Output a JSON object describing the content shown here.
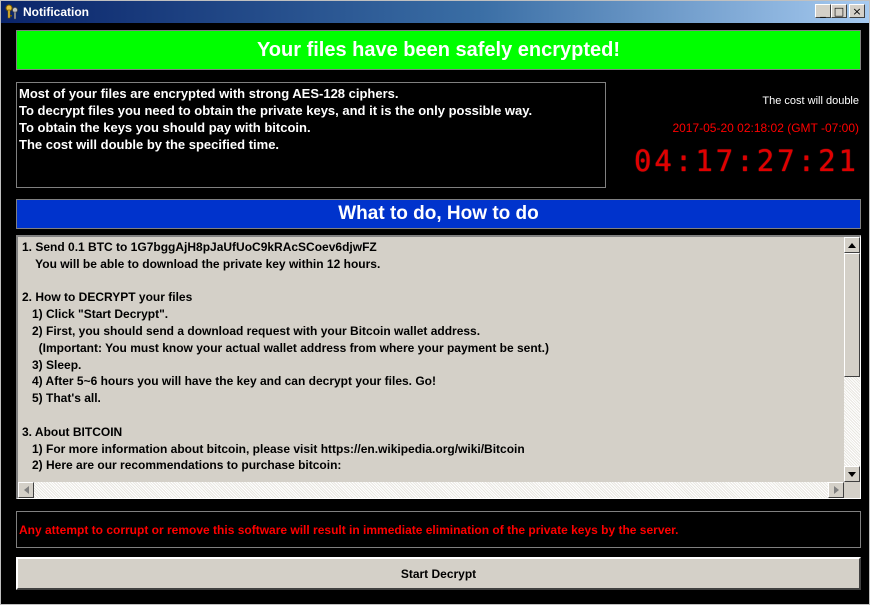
{
  "window": {
    "title": "Notification",
    "minimize_glyph": "_",
    "maximize_glyph": "□",
    "close_glyph": "×"
  },
  "header": {
    "banner": "Your files have been safely encrypted!",
    "banner_color": "#00ff00"
  },
  "info": {
    "lines": [
      "Most of your files are encrypted with strong AES-128 ciphers.",
      "To decrypt files you need to obtain the private keys, and it is the only possible way.",
      "To obtain the keys you should pay with bitcoin.",
      "The cost will double by the specified time."
    ]
  },
  "timer": {
    "cost_label": "The cost will double",
    "deadline": "2017-05-20 02:18:02 (GMT -07:00)",
    "countdown": "04:17:27:21",
    "color": "#ff0000"
  },
  "howto": {
    "banner": "What to do, How to do",
    "banner_color": "#0033cc"
  },
  "instructions": {
    "lines": [
      "1. Send 0.1 BTC to 1G7bggAjH8pJaUfUoC9kRAcSCoev6djwFZ",
      "    You will be able to download the private key within 12 hours.",
      "",
      "2. How to DECRYPT your files",
      "   1) Click \"Start Decrypt\".",
      "   2) First, you should send a download request with your Bitcoin wallet address.",
      "     (Important: You must know your actual wallet address from where your payment be sent.)",
      "   3) Sleep.",
      "   4) After 5~6 hours you will have the key and can decrypt your files. Go!",
      "   5) That's all.",
      "",
      "3. About BITCOIN",
      "   1) For more information about bitcoin, please visit https://en.wikipedia.org/wiki/Bitcoin",
      "   2) Here are our recommendations to purchase bitcoin:"
    ]
  },
  "warning": {
    "text": "Any attempt to corrupt or remove this software will result in immediate elimination of the private keys by the server."
  },
  "actions": {
    "start_decrypt": "Start Decrypt"
  }
}
